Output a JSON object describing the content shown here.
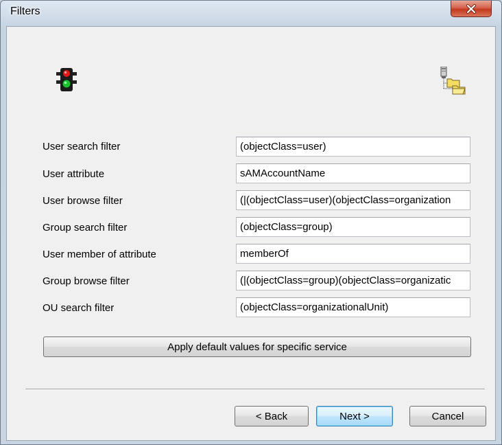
{
  "window": {
    "title": "Filters"
  },
  "icons": {
    "traffic": "traffic-light-icon",
    "folders": "server-folders-icon",
    "close": "close-icon"
  },
  "fields": [
    {
      "label": "User search filter",
      "value": "(objectClass=user)"
    },
    {
      "label": "User attribute",
      "value": "sAMAccountName"
    },
    {
      "label": "User browse filter",
      "value": "(|(objectClass=user)(objectClass=organization"
    },
    {
      "label": "Group search filter",
      "value": "(objectClass=group)"
    },
    {
      "label": "User member of attribute",
      "value": "memberOf"
    },
    {
      "label": "Group browse filter",
      "value": "(|(objectClass=group)(objectClass=organizatic"
    },
    {
      "label": "OU search filter",
      "value": "(objectClass=organizationalUnit)"
    }
  ],
  "buttons": {
    "apply_defaults": "Apply default values for specific service",
    "back": "< Back",
    "next": "Next >",
    "cancel": "Cancel"
  }
}
